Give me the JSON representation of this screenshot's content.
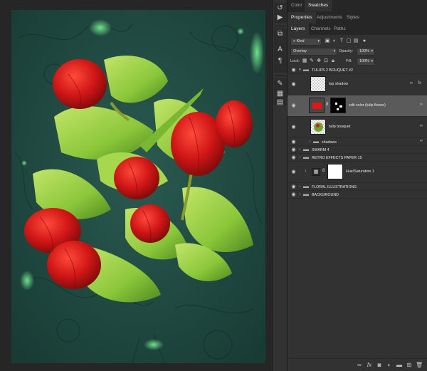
{
  "top_tabs": [
    "Color",
    "Swatches"
  ],
  "props_tabs": [
    "Properties",
    "Adjustments",
    "Styles"
  ],
  "layers_tabs": [
    "Layers",
    "Channels",
    "Paths"
  ],
  "filter": {
    "kind_label": "Kind"
  },
  "blend": {
    "mode": "Overlay",
    "opacity_label": "Opacity:",
    "opacity_value": "100%"
  },
  "lock": {
    "label": "Lock:",
    "fill_label": "Fill:",
    "fill_value": "100%"
  },
  "layers": [
    {
      "name": "TULIPS 2 BOUQUET #2"
    },
    {
      "name": "top shadow"
    },
    {
      "name": "edit color (tulip flower)"
    },
    {
      "name": "tulip bouquet"
    },
    {
      "name": "shadows"
    },
    {
      "name": "SWARM 4"
    },
    {
      "name": "RETRO EFFECTS PAPER 15"
    },
    {
      "name": "Hue/Saturation 1"
    },
    {
      "name": "FLORAL ILLUSTRATIONS"
    },
    {
      "name": "BACKGROUND"
    }
  ],
  "colors": {
    "panel_bg": "#323232",
    "selected_row": "#5a5a5a",
    "canvas_teal": "#1e4a42",
    "tulip_red": "#d41a1a",
    "leaf_green": "#8fc83a"
  },
  "icons": {
    "toolstrip": [
      "history-icon",
      "play-icon",
      "clone-source-icon",
      "character-icon",
      "paragraph-icon",
      "pen-icon",
      "properties-icon",
      "libraries-icon",
      "info-icon"
    ],
    "footer": [
      "link-layers-icon",
      "fx-icon",
      "mask-icon",
      "adjustment-icon",
      "group-icon",
      "new-layer-icon",
      "trash-icon"
    ]
  }
}
